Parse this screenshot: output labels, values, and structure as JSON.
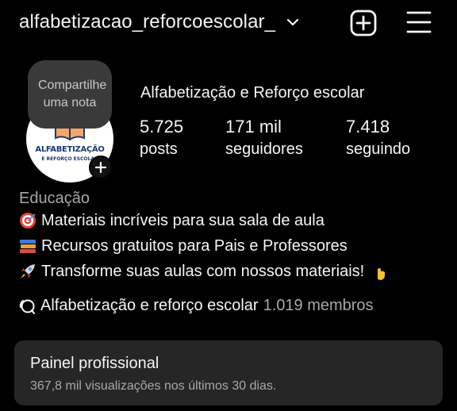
{
  "header": {
    "username": "alfabetizacao_reforcoescolar_",
    "icons": {
      "dropdown": "chevron-down-icon",
      "create": "plus-square-icon",
      "menu": "hamburger-menu-icon"
    }
  },
  "profile": {
    "note_bubble": "Compartilhe uma nota",
    "avatar_logo_line1": "ALFABETIZAÇÃO",
    "avatar_logo_line2": "E REFORÇO ESCOLAR",
    "name": "Alfabetização e Reforço escolar",
    "stats": [
      {
        "value": "5.725",
        "label": "posts"
      },
      {
        "value": "171 mil",
        "label": "seguidores"
      },
      {
        "value": "7.418",
        "label": "seguindo"
      }
    ]
  },
  "bio": {
    "category": "Educação",
    "lines": [
      {
        "icon": "target-emoji",
        "text": "Materiais incríveis para sua sala de aula"
      },
      {
        "icon": "books-emoji",
        "text": "Recursos gratuitos para Pais e Professores"
      },
      {
        "icon": "rocket-emoji",
        "text": "Transforme suas aulas com nossos materiais!"
      }
    ],
    "trailing_icon": "pointing-down-emoji"
  },
  "community": {
    "icon": "community-chat-icon",
    "name": "Alfabetização e reforço escolar",
    "members": "1.019 membros"
  },
  "dashboard": {
    "title": "Painel profissional",
    "subtitle": "367,8 mil visualizações nos últimos 30 dias."
  },
  "colors": {
    "background": "#000000",
    "text": "#f5f5f5",
    "muted": "#a8a8a8",
    "panel": "#262626",
    "note_bubble": "#3a3a3a"
  }
}
